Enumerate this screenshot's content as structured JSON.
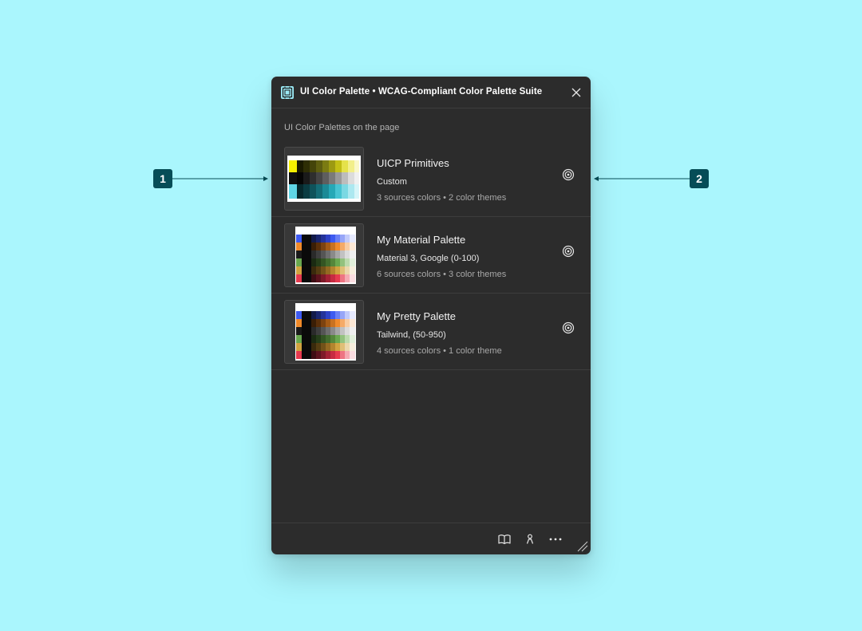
{
  "window": {
    "title": "UI Color Palette • WCAG-Compliant Color Palette Suite",
    "icon": "palette-app-icon",
    "close_icon": "close-icon"
  },
  "section_label": "UI Color Palettes on the page",
  "palettes": [
    {
      "name": "UICP Primitives",
      "preset": "Custom",
      "meta": "3 sources colors • 2 color themes",
      "swatches": [
        "#f5f000",
        "#101010",
        "#5fd6e6"
      ],
      "action_icon": "target-icon"
    },
    {
      "name": "My Material Palette",
      "preset": "Material 3, Google (0-100)",
      "meta": "6 sources colors • 3 color themes",
      "swatches": [
        "#3d5af1",
        "#f08a2a",
        "#6aa84f",
        "#d1a340",
        "#e63a4f"
      ],
      "action_icon": "target-icon"
    },
    {
      "name": "My Pretty Palette",
      "preset": "Tailwind, (50-950)",
      "meta": "4 sources colors • 1 color theme",
      "swatches": [
        "#3d5af1",
        "#f08a2a",
        "#6aa84f",
        "#d1a340",
        "#e63a4f"
      ],
      "action_icon": "target-icon"
    }
  ],
  "footer": {
    "icons": [
      "book-icon",
      "person-icon",
      "more-icon",
      "resize-icon"
    ]
  },
  "callouts": [
    {
      "label": "1"
    },
    {
      "label": "2"
    }
  ],
  "colors": {
    "background": "#aaf6fd",
    "panel": "#2c2c2c",
    "badge": "#064d57",
    "accent_icon": "#9be9f4"
  }
}
